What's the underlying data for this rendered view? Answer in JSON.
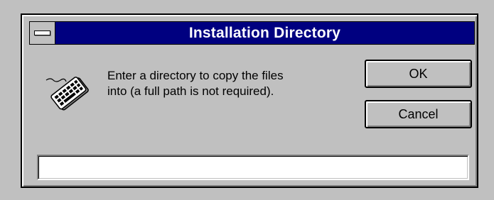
{
  "dialog": {
    "title": "Installation Directory",
    "message": "Enter a directory to copy the files\ninto (a full path is not required).",
    "input_value": ""
  },
  "buttons": {
    "ok_label": "OK",
    "cancel_label": "Cancel"
  },
  "icons": {
    "system_menu": "system-menu-icon",
    "app": "keyboard-icon"
  },
  "colors": {
    "titlebar": "#000080",
    "face": "#c0c0c0",
    "title_text": "#ffffff"
  }
}
